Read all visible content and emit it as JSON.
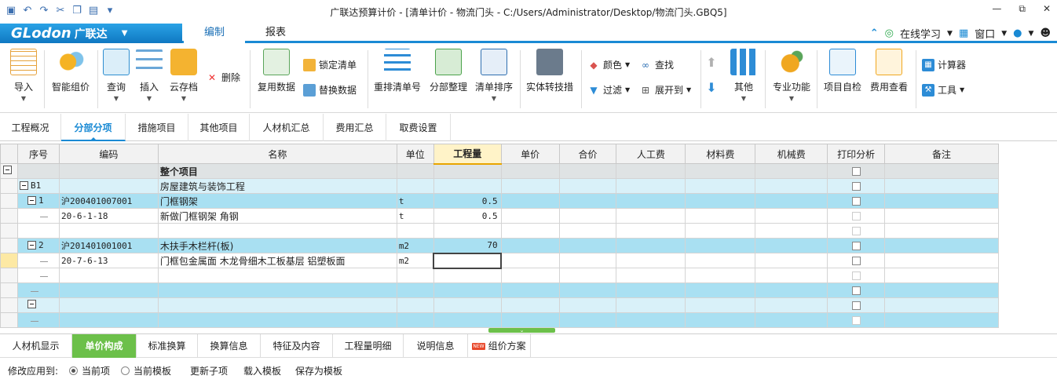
{
  "window": {
    "title": "广联达预算计价 - [清单计价 - 物流门头 - C:/Users/Administrator/Desktop/物流门头.GBQ5]",
    "controls": [
      "—",
      "⧉",
      "✕"
    ]
  },
  "menubar": {
    "brand": "GLodon",
    "brand_cn": "广联达",
    "tabs": [
      "编制",
      "报表"
    ],
    "active_tab": "编制",
    "right": {
      "online": "在线学习",
      "window": "窗口"
    }
  },
  "ribbon": {
    "import": "导入",
    "smart_price": "智能组价",
    "query": "查询",
    "insert": "插入",
    "cloud_save": "云存档",
    "delete": "删除",
    "reuse_data": "复用数据",
    "lock_list": "锁定清单",
    "replace_data": "替换数据",
    "renumber": "重排清单号",
    "section_arrange": "分部整理",
    "list_sort": "清单排序",
    "entity_convert": "实体转技措",
    "color": "颜色",
    "find": "查找",
    "filter": "过滤",
    "expand_to": "展开到",
    "other": "其他",
    "professional": "专业功能",
    "self_check": "项目自检",
    "fee_view": "费用查看",
    "calculator": "计算器",
    "tools": "工具"
  },
  "sheet_tabs": [
    "工程概况",
    "分部分项",
    "措施项目",
    "其他项目",
    "人材机汇总",
    "费用汇总",
    "取费设置"
  ],
  "active_sheet": "分部分项",
  "grid": {
    "columns": [
      "序号",
      "编码",
      "名称",
      "单位",
      "工程量",
      "单价",
      "合价",
      "人工费",
      "材料费",
      "机械费",
      "打印分析",
      "备注"
    ],
    "rows": [
      {
        "seq": "",
        "code": "",
        "name": "整个项目",
        "unit": "",
        "qty": ""
      },
      {
        "seq": "B1",
        "code": "",
        "name": "房屋建筑与装饰工程",
        "unit": "",
        "qty": ""
      },
      {
        "seq": "1",
        "code": "沪200401007001",
        "name": "门框钢架",
        "unit": "t",
        "qty": "0.5"
      },
      {
        "seq": "",
        "code": "20-6-1-18",
        "name": "新做门框钢架 角钢",
        "unit": "t",
        "qty": "0.5"
      },
      {
        "seq": "",
        "code": "",
        "name": "",
        "unit": "",
        "qty": ""
      },
      {
        "seq": "2",
        "code": "沪201401001001",
        "name": "木扶手木栏杆(板)",
        "unit": "m2",
        "qty": "70"
      },
      {
        "seq": "",
        "code": "20-7-6-13",
        "name": "门框包金属面 木龙骨细木工板基层 铝塑板面",
        "unit": "m2",
        "qty": ""
      },
      {
        "seq": "",
        "code": "",
        "name": "",
        "unit": "",
        "qty": ""
      },
      {
        "seq": "",
        "code": "",
        "name": "",
        "unit": "",
        "qty": ""
      },
      {
        "seq": "",
        "code": "",
        "name": "",
        "unit": "",
        "qty": ""
      },
      {
        "seq": "",
        "code": "",
        "name": "",
        "unit": "",
        "qty": ""
      }
    ]
  },
  "bottom_tabs": [
    "人材机显示",
    "单价构成",
    "标准换算",
    "换算信息",
    "特征及内容",
    "工程量明细",
    "说明信息",
    "组价方案"
  ],
  "active_bottom_tab": "单价构成",
  "bottom_bar": {
    "apply_label": "修改应用到:",
    "option_current_item": "当前项",
    "option_current_template": "当前模板",
    "update_child": "更新子项",
    "load_template": "载入模板",
    "save_template": "保存为模板"
  },
  "colors": {
    "accent": "#1a8ad4",
    "green_tab": "#6cc04a",
    "row_blue": "#a9e0f2",
    "row_gray": "#dfe3e4"
  }
}
